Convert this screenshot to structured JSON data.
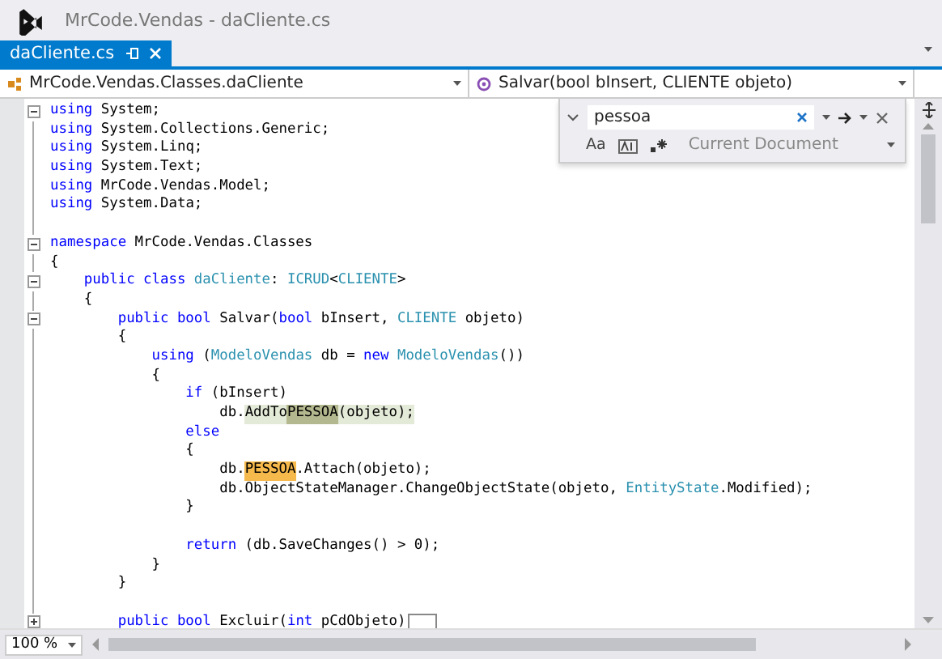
{
  "window": {
    "title": "MrCode.Vendas - daCliente.cs"
  },
  "tabs": [
    {
      "label": "daCliente.cs",
      "selected": true
    }
  ],
  "navigation": {
    "type_dropdown": "MrCode.Vendas.Classes.daCliente",
    "member_dropdown": "Salvar(bool bInsert, CLIENTE objeto)"
  },
  "find": {
    "value": "pessoa",
    "match_case_label": "Aa",
    "scope": "Current Document"
  },
  "code_lines": [
    {
      "foldable": true,
      "expanded": true,
      "tokens": [
        {
          "kind": "keyword",
          "text": "using"
        },
        {
          "kind": "plain",
          "text": " System;"
        }
      ]
    },
    {
      "foldable": false,
      "tokens": [
        {
          "kind": "keyword",
          "text": "using"
        },
        {
          "kind": "plain",
          "text": " System.Collections.Generic;"
        }
      ]
    },
    {
      "foldable": false,
      "tokens": [
        {
          "kind": "keyword",
          "text": "using"
        },
        {
          "kind": "plain",
          "text": " System.Linq;"
        }
      ]
    },
    {
      "foldable": false,
      "tokens": [
        {
          "kind": "keyword",
          "text": "using"
        },
        {
          "kind": "plain",
          "text": " System.Text;"
        }
      ]
    },
    {
      "foldable": false,
      "tokens": [
        {
          "kind": "keyword",
          "text": "using"
        },
        {
          "kind": "plain",
          "text": " MrCode.Vendas.Model;"
        }
      ]
    },
    {
      "foldable": false,
      "tokens": [
        {
          "kind": "keyword",
          "text": "using"
        },
        {
          "kind": "plain",
          "text": " System.Data;"
        }
      ]
    },
    {
      "foldable": false
    },
    {
      "foldable": true,
      "expanded": true,
      "tokens": [
        {
          "kind": "keyword",
          "text": "namespace"
        },
        {
          "kind": "plain",
          "text": " MrCode.Vendas.Classes"
        }
      ]
    },
    {
      "foldable": false,
      "tokens": [
        {
          "kind": "plain",
          "text": "{"
        }
      ]
    },
    {
      "foldable": true,
      "expanded": true,
      "tokens": [
        {
          "kind": "keyword",
          "text": "    public class "
        },
        {
          "kind": "type",
          "text": "daCliente"
        },
        {
          "kind": "plain",
          "text": ": "
        },
        {
          "kind": "type",
          "text": "ICRUD"
        },
        {
          "kind": "plain",
          "text": "<"
        },
        {
          "kind": "type",
          "text": "CLIENTE"
        },
        {
          "kind": "plain",
          "text": ">"
        }
      ]
    },
    {
      "foldable": false,
      "tokens": [
        {
          "kind": "plain",
          "text": "    {"
        }
      ]
    },
    {
      "foldable": true,
      "expanded": true,
      "tokens": [
        {
          "kind": "keyword",
          "text": "        public bool"
        },
        {
          "kind": "plain",
          "text": " Salvar("
        },
        {
          "kind": "keyword",
          "text": "bool"
        },
        {
          "kind": "plain",
          "text": " bInsert, "
        },
        {
          "kind": "type",
          "text": "CLIENTE"
        },
        {
          "kind": "plain",
          "text": " objeto)"
        }
      ]
    },
    {
      "foldable": false,
      "tokens": [
        {
          "kind": "plain",
          "text": "        {"
        }
      ]
    },
    {
      "foldable": false,
      "tokens": [
        {
          "kind": "keyword",
          "text": "            using"
        },
        {
          "kind": "plain",
          "text": " ("
        },
        {
          "kind": "type",
          "text": "ModeloVendas"
        },
        {
          "kind": "plain",
          "text": " db = "
        },
        {
          "kind": "keyword",
          "text": "new "
        },
        {
          "kind": "type",
          "text": "ModeloVendas"
        },
        {
          "kind": "plain",
          "text": "())"
        }
      ]
    },
    {
      "foldable": false,
      "tokens": [
        {
          "kind": "plain",
          "text": "            {"
        }
      ]
    },
    {
      "foldable": false,
      "tokens": [
        {
          "kind": "keyword",
          "text": "                if"
        },
        {
          "kind": "plain",
          "text": " (bInsert)"
        }
      ]
    },
    {
      "foldable": false,
      "tokens": [
        {
          "kind": "plain",
          "text": "                    db."
        },
        {
          "kind": "tint",
          "text": "AddTo"
        },
        {
          "kind": "current-match",
          "text": "PESSOA"
        },
        {
          "kind": "tint",
          "text": "(objeto);"
        }
      ]
    },
    {
      "foldable": false,
      "tokens": [
        {
          "kind": "keyword",
          "text": "                else"
        }
      ]
    },
    {
      "foldable": false,
      "tokens": [
        {
          "kind": "plain",
          "text": "                {"
        }
      ]
    },
    {
      "foldable": false,
      "tokens": [
        {
          "kind": "plain",
          "text": "                    db."
        },
        {
          "kind": "match",
          "text": "PESSOA"
        },
        {
          "kind": "plain",
          "text": ".Attach(objeto);"
        }
      ]
    },
    {
      "foldable": false,
      "tokens": [
        {
          "kind": "plain",
          "text": "                    db.ObjectStateManager.ChangeObjectState(objeto, "
        },
        {
          "kind": "type",
          "text": "EntityState"
        },
        {
          "kind": "plain",
          "text": ".Modified);"
        }
      ]
    },
    {
      "foldable": false,
      "tokens": [
        {
          "kind": "plain",
          "text": "                }"
        }
      ]
    },
    {
      "foldable": false
    },
    {
      "foldable": false,
      "tokens": [
        {
          "kind": "keyword",
          "text": "                return"
        },
        {
          "kind": "plain",
          "text": " (db.SaveChanges() > 0);"
        }
      ]
    },
    {
      "foldable": false,
      "tokens": [
        {
          "kind": "plain",
          "text": "            }"
        }
      ]
    },
    {
      "foldable": false,
      "tokens": [
        {
          "kind": "plain",
          "text": "        }"
        }
      ]
    },
    {
      "foldable": false
    },
    {
      "foldable": true,
      "expanded": false,
      "tokens": [
        {
          "kind": "keyword",
          "text": "        public bool"
        },
        {
          "kind": "plain",
          "text": " Excluir("
        },
        {
          "kind": "keyword",
          "text": "int"
        },
        {
          "kind": "plain",
          "text": " pCdObjeto)"
        }
      ]
    }
  ],
  "status": {
    "zoom": "100 %"
  }
}
